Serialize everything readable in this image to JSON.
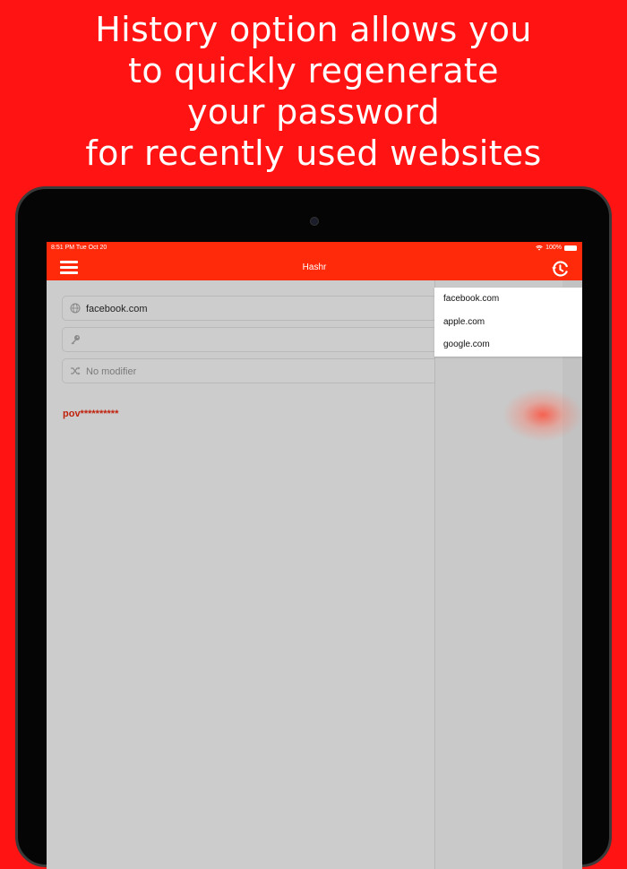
{
  "headline": {
    "lines": [
      "History option allows you",
      "to quickly regenerate",
      "your password",
      "for recently used websites"
    ]
  },
  "statusbar": {
    "time": "8:51 PM   Tue Oct 20",
    "battery": "100%"
  },
  "navbar": {
    "title": "Hashr",
    "menu_icon": "hamburger-icon",
    "history_icon": "history-icon"
  },
  "form": {
    "website_value": "facebook.com",
    "website_icon": "globe-icon",
    "password_value": "",
    "password_icon": "key-icon",
    "modifier_placeholder": "No modifier",
    "modifier_icon": "shuffle-icon"
  },
  "result": {
    "hashed_password": "pov**********"
  },
  "history": {
    "items": [
      "facebook.com",
      "apple.com",
      "google.com"
    ]
  },
  "colors": {
    "background": "#ff1313",
    "toolbar": "#ff2a0a",
    "hash_text": "#c0210b"
  }
}
